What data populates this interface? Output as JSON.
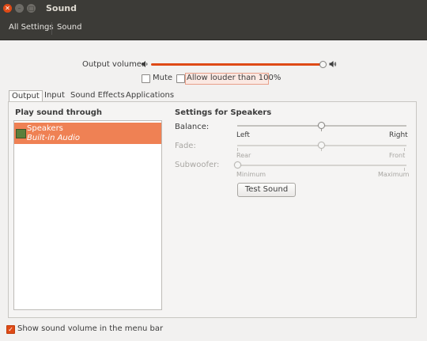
{
  "window": {
    "title": "Sound",
    "close_glyph": "✕",
    "min_glyph": "–",
    "max_glyph": "□"
  },
  "toolbar": {
    "all_settings": "All Settings",
    "sound": "Sound"
  },
  "output_volume": {
    "label": "Output volume:",
    "level": 1.0,
    "low_icon": "speaker-low-icon",
    "high_icon": "speaker-high-icon",
    "mute_label": "Mute",
    "mute_checked": false,
    "allow_louder_label": "Allow louder than 100%",
    "allow_louder_checked": false
  },
  "tabs": [
    {
      "label": "Output",
      "active": true
    },
    {
      "label": "Input",
      "active": false
    },
    {
      "label": "Sound Effects",
      "active": false
    },
    {
      "label": "Applications",
      "active": false
    }
  ],
  "output": {
    "play_through_heading": "Play sound through",
    "devices": [
      {
        "name": "Speakers",
        "subtitle": "Built-in Audio",
        "selected": true
      }
    ],
    "settings_heading": "Settings for Speakers",
    "balance": {
      "label": "Balance:",
      "left": "Left",
      "right": "Right",
      "value": 0.5
    },
    "fade": {
      "label": "Fade:",
      "left": "Rear",
      "right": "Front",
      "value": 0.5
    },
    "subwoofer": {
      "label": "Subwoofer:",
      "left": "Minimum",
      "right": "Maximum",
      "value": 0.0
    },
    "test_button": "Test Sound"
  },
  "footer": {
    "show_volume_label": "Show sound volume in the menu bar",
    "show_volume_checked": true
  },
  "colors": {
    "accent": "#df4a16",
    "selection": "#ef8154",
    "titlebar": "#3c3b37"
  }
}
